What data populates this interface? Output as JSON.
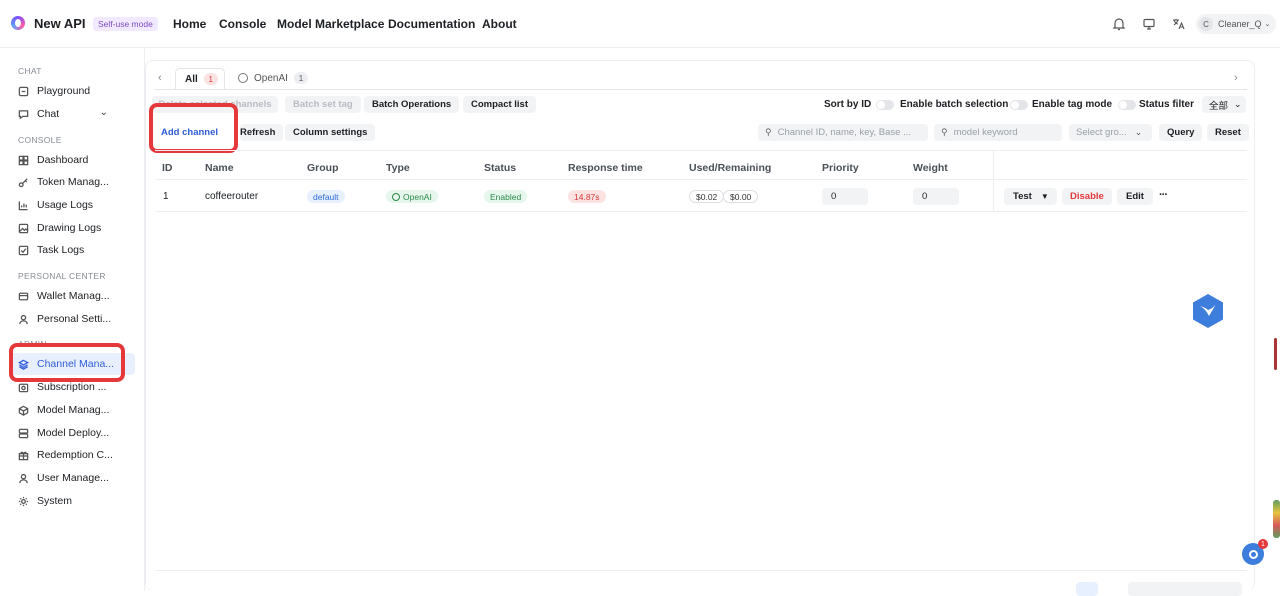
{
  "app": {
    "name": "New API",
    "mode_badge": "Self-use mode"
  },
  "nav": {
    "home": "Home",
    "console": "Console",
    "marketplace": "Model Marketplace",
    "docs": "Documentation",
    "about": "About"
  },
  "user": {
    "initial": "C",
    "name": "Cleaner_Q"
  },
  "sidebar": {
    "sections": {
      "chat": "CHAT",
      "console": "CONSOLE",
      "personal": "PERSONAL CENTER",
      "admin": "ADMIN"
    },
    "items": {
      "playground": "Playground",
      "chat": "Chat",
      "dashboard": "Dashboard",
      "token": "Token Manag...",
      "usage": "Usage Logs",
      "drawing": "Drawing Logs",
      "task": "Task Logs",
      "wallet": "Wallet Manag...",
      "personal": "Personal Setti...",
      "channel": "Channel Mana...",
      "subscription": "Subscription ...",
      "model_manage": "Model Manag...",
      "model_deploy": "Model Deploy...",
      "redemption": "Redemption C...",
      "user_manage": "User Manage...",
      "system": "System"
    }
  },
  "tabs": [
    {
      "label": "All",
      "count": "1"
    },
    {
      "label": "OpenAI",
      "count": "1"
    }
  ],
  "toolbar": {
    "delete_selected": "Delete selected channels",
    "batch_set_tag": "Batch set tag",
    "batch_ops": "Batch Operations",
    "compact_list": "Compact list",
    "sort_by_id": "Sort by ID",
    "enable_batch": "Enable batch selection",
    "enable_tag": "Enable tag mode",
    "status_filter": "Status filter",
    "status_value": "全部",
    "add_channel": "Add channel",
    "refresh": "Refresh",
    "column_settings": "Column settings",
    "search_placeholder": "Channel ID, name, key, Base ...",
    "model_placeholder": "model keyword",
    "group_placeholder": "Select gro...",
    "query": "Query",
    "reset": "Reset"
  },
  "table": {
    "headers": [
      "ID",
      "Name",
      "Group",
      "Type",
      "Status",
      "Response time",
      "Used/Remaining",
      "Priority",
      "Weight"
    ],
    "rows": [
      {
        "id": "1",
        "name": "coffeerouter",
        "group": "default",
        "type": "OpenAI",
        "status": "Enabled",
        "response": "14.87s",
        "used": "$0.02",
        "remaining": "$0.00",
        "priority": "0",
        "weight": "0",
        "test": "Test",
        "disable": "Disable",
        "edit": "Edit",
        "more": "···"
      }
    ]
  },
  "notif_count": "1",
  "colors": {
    "accent": "#2f5cd6",
    "danger": "#e5383b",
    "highlight": "#e5383b"
  }
}
